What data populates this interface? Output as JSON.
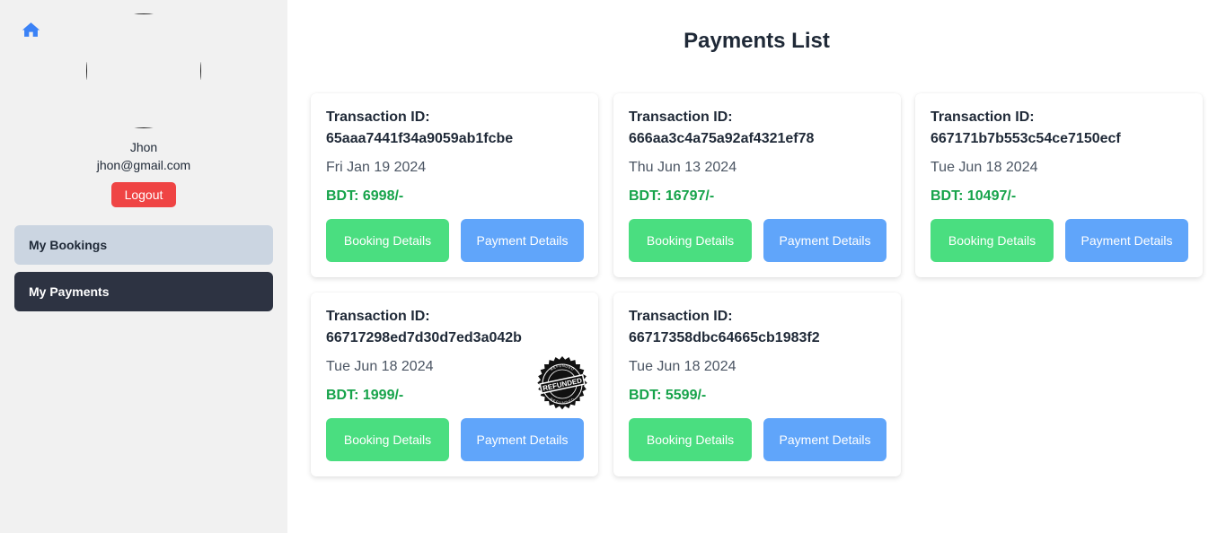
{
  "sidebar": {
    "user": {
      "name": "Jhon",
      "email": "jhon@gmail.com"
    },
    "logout_label": "Logout",
    "nav": [
      {
        "label": "My Bookings",
        "active": false
      },
      {
        "label": "My Payments",
        "active": true
      }
    ]
  },
  "main": {
    "title": "Payments List",
    "cards": [
      {
        "tx_label": "Transaction ID:",
        "tx_id": "65aaa7441f34a9059ab1fcbe",
        "date": "Fri Jan 19 2024",
        "amount": "BDT: 6998/-",
        "booking_label": "Booking Details",
        "payment_label": "Payment Details",
        "refunded": false
      },
      {
        "tx_label": "Transaction ID:",
        "tx_id": "666aa3c4a75a92af4321ef78",
        "date": "Thu Jun 13 2024",
        "amount": "BDT: 16797/-",
        "booking_label": "Booking Details",
        "payment_label": "Payment Details",
        "refunded": false
      },
      {
        "tx_label": "Transaction ID:",
        "tx_id": "667171b7b553c54ce7150ecf",
        "date": "Tue Jun 18 2024",
        "amount": "BDT: 10497/-",
        "booking_label": "Booking Details",
        "payment_label": "Payment Details",
        "refunded": false
      },
      {
        "tx_label": "Transaction ID:",
        "tx_id": "66717298ed7d30d7ed3a042b",
        "date": "Tue Jun 18 2024",
        "amount": "BDT: 1999/-",
        "booking_label": "Booking Details",
        "payment_label": "Payment Details",
        "refunded": true,
        "stamp": {
          "main_text": "REFUNDED",
          "ring_text": "REFUNDED"
        }
      },
      {
        "tx_label": "Transaction ID:",
        "tx_id": "66717358dbc64665cb1983f2",
        "date": "Tue Jun 18 2024",
        "amount": "BDT: 5599/-",
        "booking_label": "Booking Details",
        "payment_label": "Payment Details",
        "refunded": false
      }
    ]
  },
  "colors": {
    "sidebar_bg": "#f1f1f1",
    "active_nav_bg": "#2d3342",
    "inactive_nav_bg": "#cbd5e1",
    "logout": "#ef4444",
    "booking_button": "#4ade80",
    "payment_button": "#60a5fa",
    "amount": "#16a34a",
    "home_icon": "#3b82f6"
  },
  "icons": {
    "home": "home-icon",
    "stamp": "refunded-stamp-icon"
  }
}
